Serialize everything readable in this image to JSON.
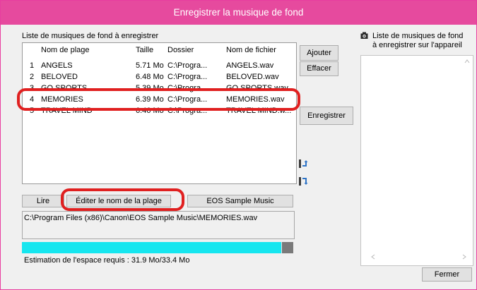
{
  "window": {
    "title": "Enregistrer la musique de fond"
  },
  "left_panel": {
    "title": "Liste de musiques de fond à enregistrer",
    "columns": [
      "Nom de plage",
      "Taille",
      "Dossier",
      "Nom de fichier"
    ],
    "rows": [
      {
        "num": "1",
        "name": "ANGELS",
        "size": "5.71 Mo",
        "folder": "C:\\Progra...",
        "file": "ANGELS.wav"
      },
      {
        "num": "2",
        "name": "BELOVED",
        "size": "6.48 Mo",
        "folder": "C:\\Progra...",
        "file": "BELOVED.wav"
      },
      {
        "num": "3",
        "name": "GO SPORTS",
        "size": "5.39 Mo",
        "folder": "C:\\Progra...",
        "file": "GO SPORTS.wav"
      },
      {
        "num": "4",
        "name": "MEMORIES",
        "size": "6.39 Mo",
        "folder": "C:\\Progra...",
        "file": "MEMORIES.wav"
      },
      {
        "num": "5",
        "name": "TRAVEL MIND",
        "size": "6.46 Mo",
        "folder": "C:\\Progra...",
        "file": "TRAVEL MIND.w..."
      }
    ],
    "buttons": {
      "play": "Lire",
      "edit": "Éditer le nom de la plage",
      "sample": "EOS Sample Music"
    },
    "path": "C:\\Program Files (x86)\\Canon\\EOS Sample Music\\MEMORIES.wav",
    "progress": {
      "fraction": 0.955
    },
    "estimate": "Estimation de l'espace requis : 31.9 Mo/33.4 Mo"
  },
  "middle_buttons": {
    "add": "Ajouter",
    "remove": "Effacer",
    "register": "Enregistrer"
  },
  "right_panel": {
    "title_line1": "Liste de musiques de fond",
    "title_line2": "à enregistrer sur l'appareil"
  },
  "footer": {
    "close": "Fermer"
  },
  "colors": {
    "titlebar": "#e64a9e",
    "progress": "#16e6ef",
    "highlight": "#e02020"
  }
}
